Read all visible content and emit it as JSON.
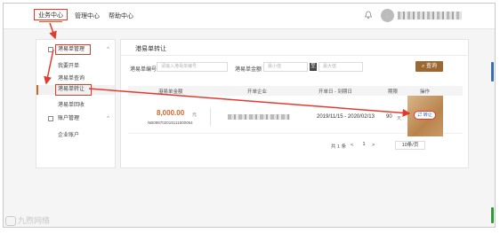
{
  "topbar": {
    "nav": [
      "业务中心",
      "管理中心",
      "帮助中心"
    ]
  },
  "sidebar": {
    "group1": "港易单管理",
    "items": [
      "我要开单",
      "港易单查询",
      "港易单转让",
      "港易单回收"
    ],
    "group2": "账户管理",
    "group2_items": [
      "企业账户"
    ]
  },
  "content": {
    "title": "港易单转让",
    "filters": {
      "no_label": "港易单编号",
      "no_placeholder": "请输入港易单编号",
      "amount_label": "港易单金额",
      "min_placeholder": "最小值",
      "sep": "至",
      "max_placeholder": "最大值",
      "query_label": "查询"
    },
    "table": {
      "headers": [
        "港易单金额",
        "开单企业",
        "开单日 - 到期日",
        "期限",
        "操作"
      ],
      "rows": [
        {
          "amount": "8,000.00",
          "unit": "元",
          "doc_no": "NB098702019111500054",
          "period": "2019/11/15 - 2020/02/13",
          "days": "90",
          "days_unit": "天",
          "action": "转让"
        }
      ]
    },
    "pager": {
      "total": "共 1 条",
      "prev": "<",
      "page": "1",
      "next": ">",
      "page_size": "10条/页"
    }
  },
  "watermark": "九煦网络",
  "colors": {
    "accent": "#9b6830",
    "amount": "#d0662a",
    "annotation": "#e23b2e"
  }
}
